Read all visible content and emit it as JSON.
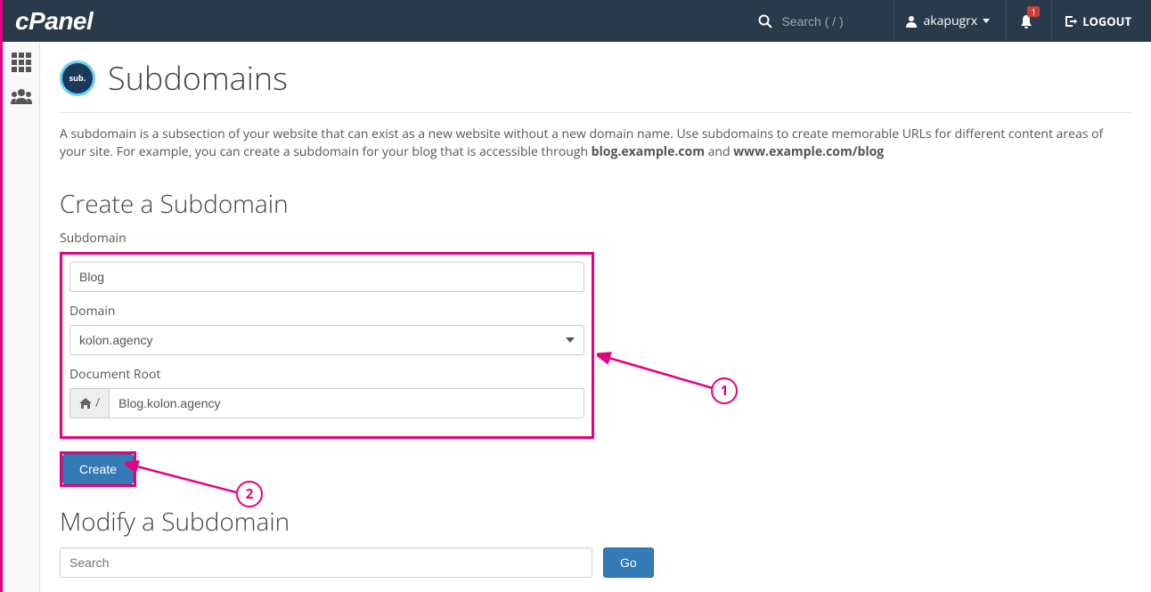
{
  "header": {
    "logo": "cPanel",
    "search_placeholder": "Search ( / )",
    "username": "akapugrx",
    "notification_count": "1",
    "logout_label": "LOGOUT"
  },
  "page": {
    "icon_text": "sub.",
    "title": "Subdomains",
    "intro_prefix": "A subdomain is a subsection of your website that can exist as a new website without a new domain name. Use subdomains to create memorable URLs for different content areas of your site. For example, you can create a subdomain for your blog that is accessible through ",
    "intro_bold1": "blog.example.com",
    "intro_mid": " and ",
    "intro_bold2": "www.example.com/blog"
  },
  "create": {
    "title": "Create a Subdomain",
    "subdomain_label": "Subdomain",
    "subdomain_value": "Blog",
    "domain_label": "Domain",
    "domain_value": "kolon.agency",
    "docroot_label": "Document Root",
    "docroot_prefix": "/",
    "docroot_value": "Blog.kolon.agency",
    "button_label": "Create"
  },
  "modify": {
    "title": "Modify a Subdomain",
    "search_placeholder": "Search",
    "go_label": "Go"
  },
  "annotations": {
    "one": "1",
    "two": "2"
  }
}
